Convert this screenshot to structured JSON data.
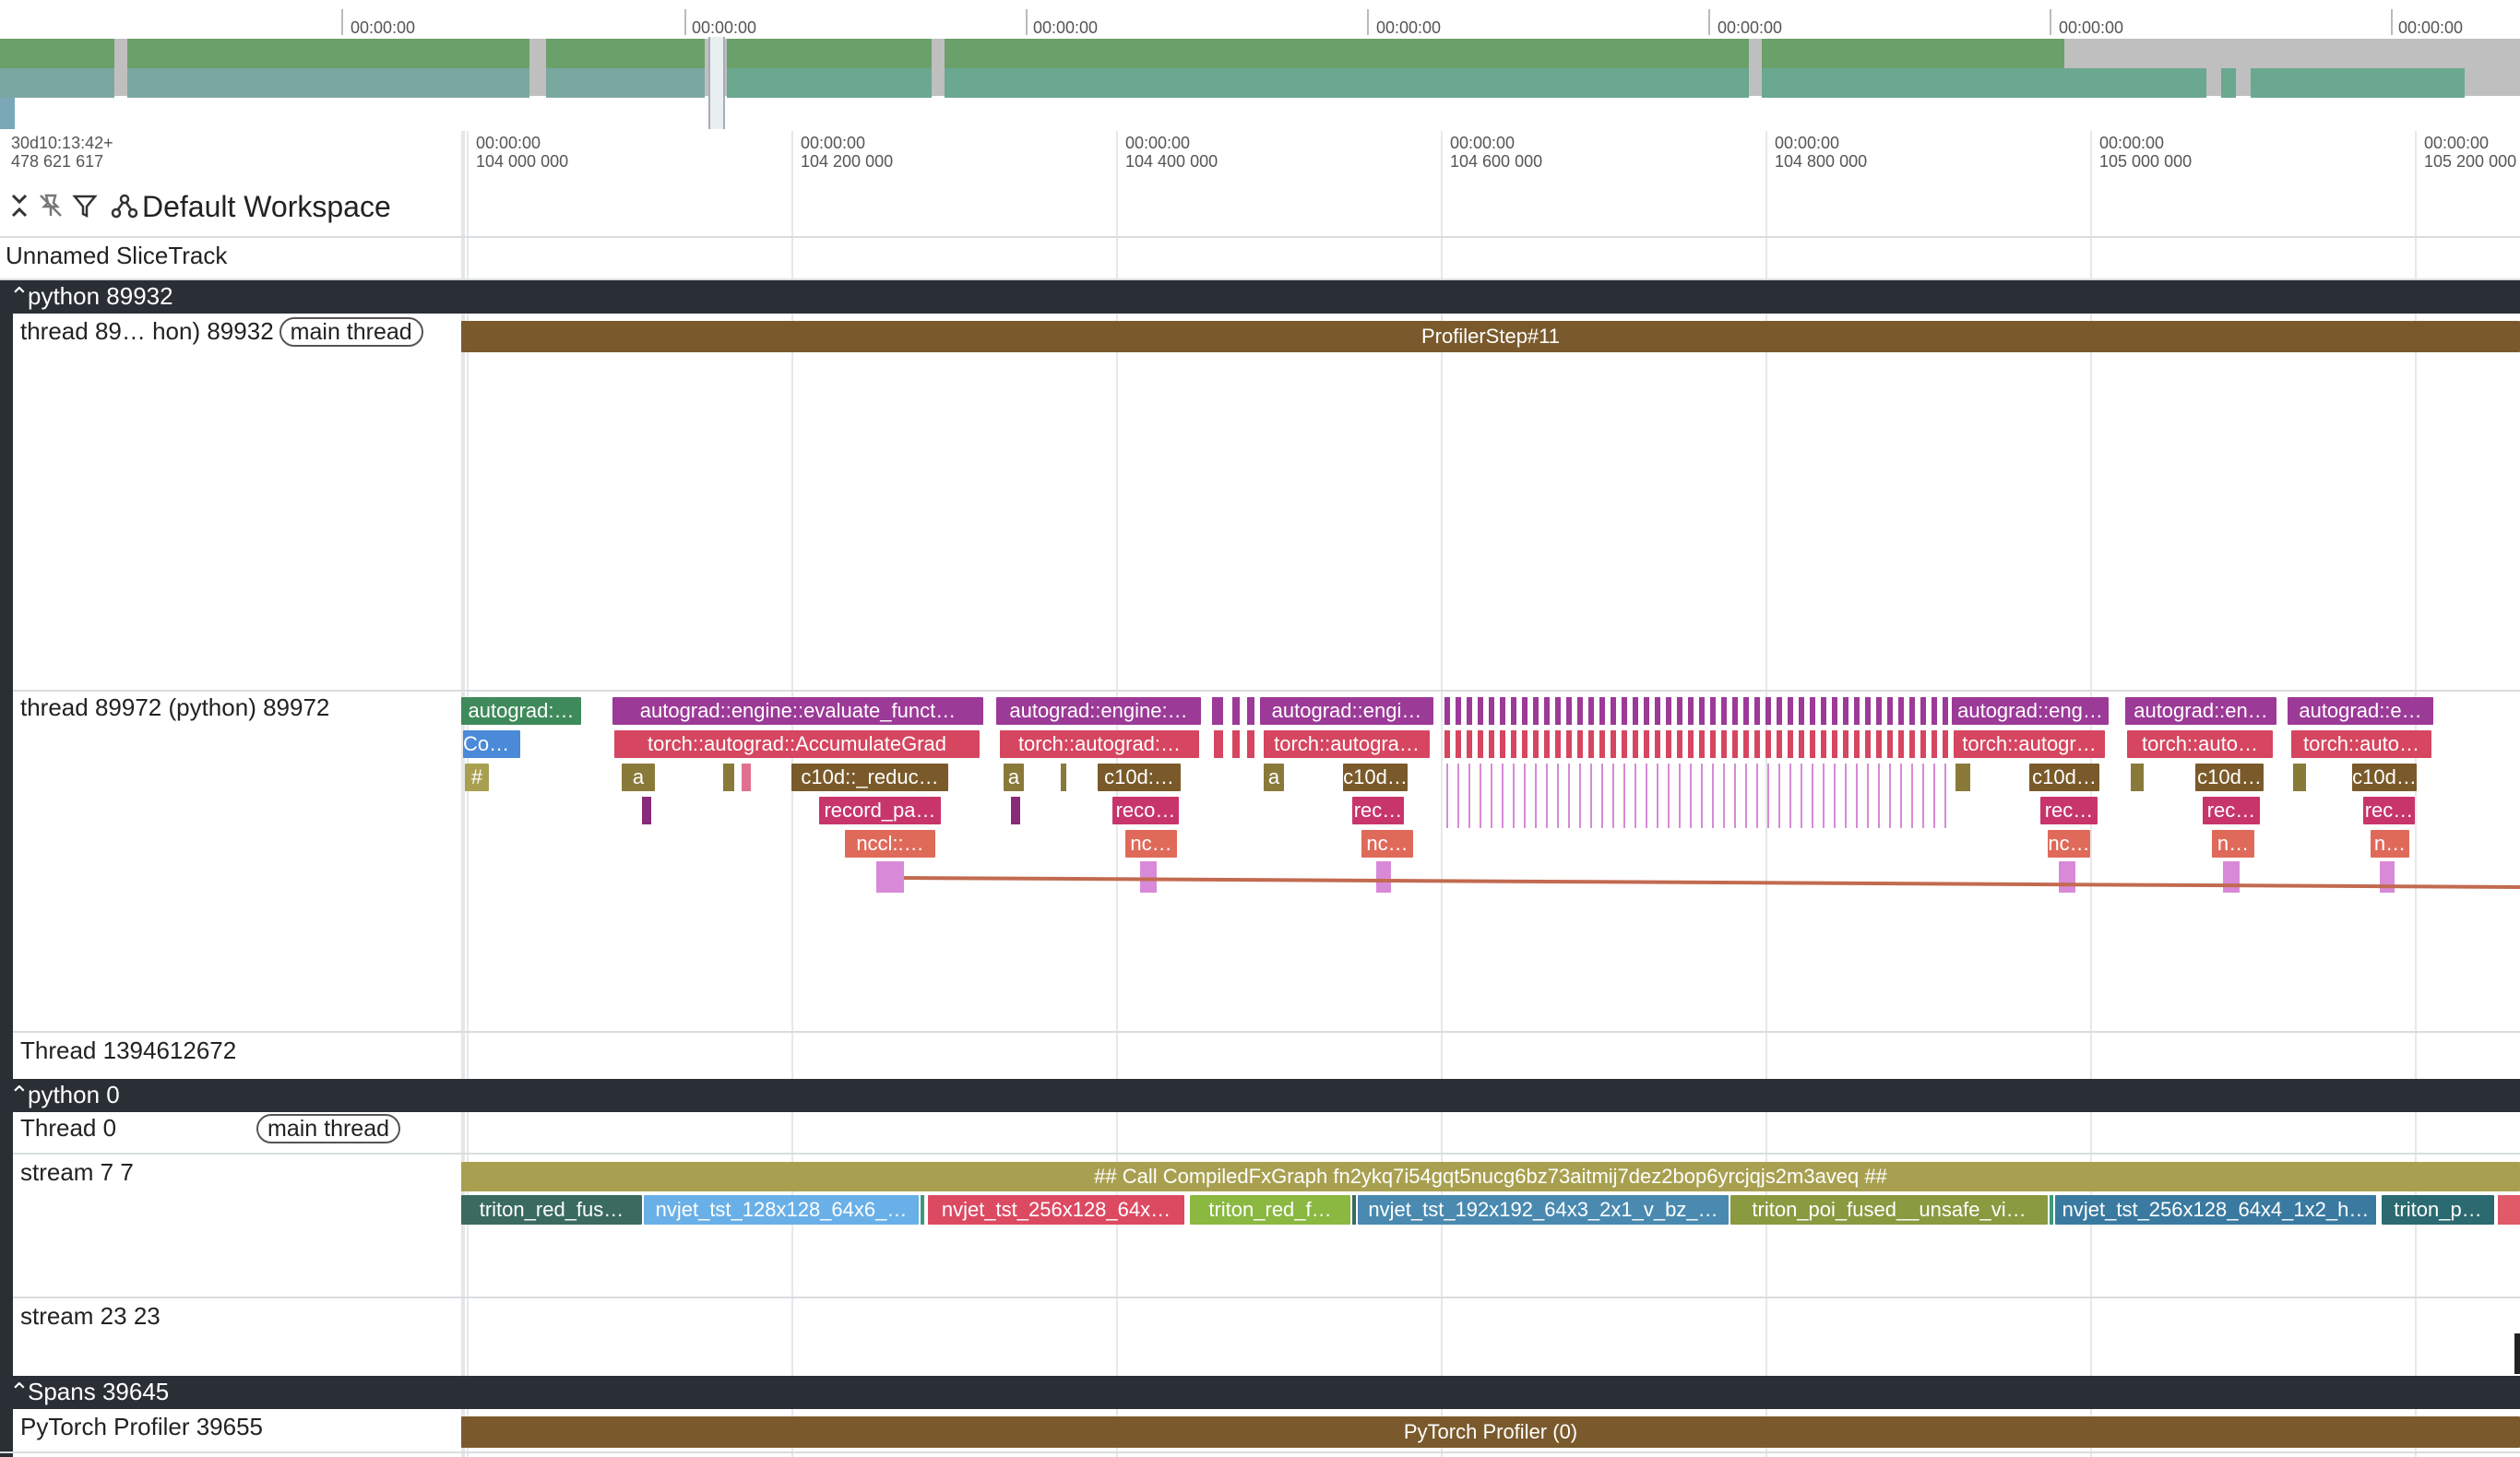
{
  "overview": {
    "tick_labels": [
      "00:00:00",
      "00:00:00",
      "00:00:00",
      "00:00:00",
      "00:00:00",
      "00:00:00",
      "00:00:00"
    ]
  },
  "ruler": {
    "origin_line1": "30d10:13:42+",
    "origin_line2": "478 621 617",
    "ticks": [
      {
        "l1": "00:00:00",
        "l2": "104 000 000"
      },
      {
        "l1": "00:00:00",
        "l2": "104 200 000"
      },
      {
        "l1": "00:00:00",
        "l2": "104 400 000"
      },
      {
        "l1": "00:00:00",
        "l2": "104 600 000"
      },
      {
        "l1": "00:00:00",
        "l2": "104 800 000"
      },
      {
        "l1": "00:00:00",
        "l2": "105 000 000"
      },
      {
        "l1": "00:00:00",
        "l2": "105 200 000"
      }
    ]
  },
  "toolbar": {
    "collapse_icon": "collapse-icon",
    "unpin_icon": "unpin-icon",
    "filter_icon": "filter-icon",
    "workspace_icon": "workspace-icon",
    "workspace_label": "Default Workspace"
  },
  "tracks": {
    "unnamed": "Unnamed SliceTrack",
    "group1": "python 89932",
    "thread_main": "thread 89… hon) 89932",
    "main_thread_pill": "main thread",
    "thread_worker": "thread 89972 (python) 89972",
    "thread_other": "Thread 1394612672",
    "group2": "python 0",
    "thread0": "Thread 0",
    "thread0_pill": "main thread",
    "stream7": "stream 7 7",
    "stream23": "stream 23 23",
    "group3": "Spans 39645",
    "pytorch_profiler": "PyTorch Profiler 39655"
  },
  "slices": {
    "profiler_step": "ProfilerStep#11",
    "s1": "autograd:…",
    "s2": "Com…",
    "s3": "#",
    "s4": "autograd::engine::evaluate_funct…",
    "s5": "torch::autograd::AccumulateGrad",
    "s6": "a",
    "s7": "c10d::_reduc…",
    "s8": "record_pa…",
    "s9": "nccl::…",
    "s10": "autograd::engine:…",
    "s11": "torch::autograd:…",
    "s12": "a",
    "s13": "c10d:…",
    "s14": "reco…",
    "s15": "nc…",
    "s16": "autograd::engi…",
    "s17": "torch::autogra…",
    "s18": "a",
    "s19": "c10d…",
    "s20": "rec…",
    "s21": "nc…",
    "s22": "autograd::eng…",
    "s23": "torch::autogr…",
    "s24": "c10d…",
    "s25": "rec…",
    "s26": "nc…",
    "s27": "autograd::en…",
    "s28": "torch::auto…",
    "s29": "c10d…",
    "s30": "rec…",
    "s31": "n…",
    "s32": "autograd::e…",
    "s33": "torch::auto…",
    "s34": "c10d…",
    "s35": "rec…",
    "s36": "n…",
    "compiled": "## Call CompiledFxGraph fn2ykq7i54gqt5nucg6bz73aitmij7dez2bop6yrcjqjs2m3aveq ##",
    "k1": "triton_red_fus…",
    "k2": "nvjet_tst_128x128_64x6_…",
    "k3": "nvjet_tst_256x128_64x…",
    "k4": "triton_red_f…",
    "k5": "nvjet_tst_192x192_64x3_2x1_v_bz_…",
    "k6": "triton_poi_fused__unsafe_vi…",
    "k7": "nvjet_tst_256x128_64x4_1x2_h…",
    "k8": "triton_p…",
    "pytorch_profiler_slice": "PyTorch Profiler (0)"
  },
  "colors": {
    "group_header": "#2a2e35",
    "profiler_step": "#7a5a2c",
    "autograd": "#9c3a98",
    "torch_autograd": "#d64660",
    "c10d": "#7a5a2a",
    "record": "#c8356a",
    "nccl": "#e06a5a",
    "compiled": "#a8a050",
    "pytorch_profiler": "#7a5a2c"
  }
}
